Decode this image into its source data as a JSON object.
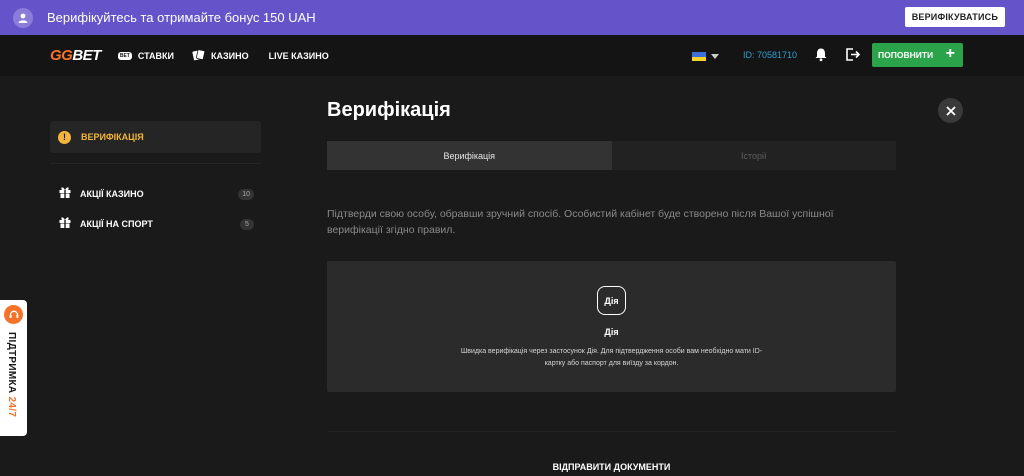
{
  "banner": {
    "text": "Верифікуйтесь та отримайте бонус 150 UAH",
    "button": "ВЕРИФІКУВАТИСЬ",
    "icon": "user-icon"
  },
  "nav": {
    "logo_gg": "GG",
    "logo_bet": "BET",
    "items": [
      {
        "label": "СТАВКИ",
        "icon": "bet-icon",
        "badge": "BET"
      },
      {
        "label": "КАЗИНО",
        "icon": "cards-icon"
      },
      {
        "label": "LIVE КАЗИНО"
      }
    ],
    "language": "ukraine-flag-icon",
    "user_id": "ID: 70581710",
    "deposit": "ПОПОВНИТИ",
    "deposit_icon": "+"
  },
  "sidebar": {
    "active": {
      "label": "ВЕРИФІКАЦІЯ",
      "icon": "!"
    },
    "items": [
      {
        "label": "АКЦІЇ КАЗИНО",
        "count": "10",
        "icon": "gift-icon"
      },
      {
        "label": "АКЦІЇ НА СПОРТ",
        "count": "5",
        "icon": "gift-icon"
      }
    ]
  },
  "support": {
    "label": "ПІДТРИМКА",
    "hours": "24/7"
  },
  "main": {
    "title": "Верифікація",
    "tabs": [
      {
        "label": "Верифікація",
        "active": true
      },
      {
        "label": "Історії",
        "active": false
      }
    ],
    "description": "Підтверди свою особу, обравши зручний спосіб. Особистий кабінет буде створено після Вашої успішної верифікації згідно правил.",
    "card": {
      "logo": "Дія",
      "title": "Дія",
      "text": "Швидка верифікація через застосунок Дія. Для підтвердження особи вам необхідно мати ID-картку або паспорт для виїзду за кордон."
    },
    "submit": "ВІДПРАВИТИ ДОКУМЕНТИ"
  },
  "colors": {
    "accent": "#f5722a",
    "banner": "#6553c9",
    "deposit": "#2ba34b",
    "warning": "#f3b63a",
    "id": "#2f9fd0"
  }
}
